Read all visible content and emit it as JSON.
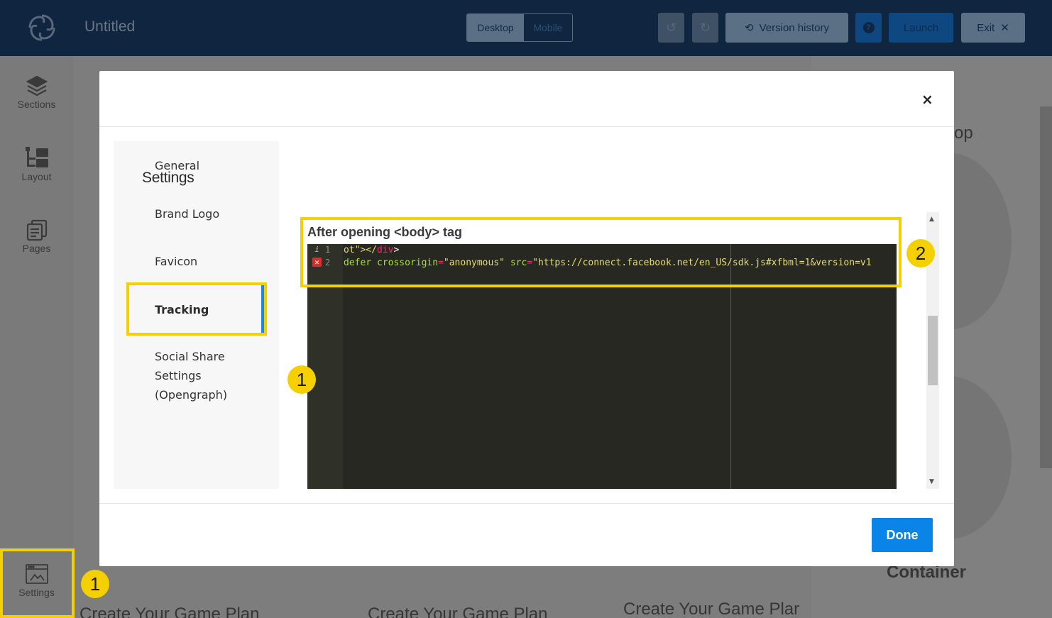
{
  "app": {
    "doc_title": "Untitled",
    "device_toggle": {
      "desktop": "Desktop",
      "mobile": "Mobile"
    },
    "toolbar": {
      "version_history": "Version history",
      "help": "?",
      "launch": "Launch",
      "exit": "Exit"
    }
  },
  "sidebar": {
    "items": [
      {
        "label": "Sections",
        "icon": "layers-icon"
      },
      {
        "label": "Layout",
        "icon": "layout-icon"
      },
      {
        "label": "Pages",
        "icon": "pages-icon"
      },
      {
        "label": "Settings",
        "icon": "settings-icon"
      }
    ]
  },
  "background": {
    "texts": [
      "Create Your Game Plan",
      "Create Your Game Plan",
      "Create Your Game Plar",
      "Container",
      "op"
    ]
  },
  "modal": {
    "close": "×",
    "nav_title": "Settings",
    "nav_items": [
      {
        "label": "General"
      },
      {
        "label": "Brand Logo"
      },
      {
        "label": "Favicon"
      },
      {
        "label": "Tracking",
        "active": true
      },
      {
        "label": "Social Share Settings (Opengraph)"
      }
    ],
    "code_label": "After opening <body> tag",
    "code_lines": [
      {
        "num": "1",
        "marker": "i",
        "text_before": "ot\"></",
        "tag": "div",
        "text_after": ">"
      },
      {
        "num": "2",
        "marker": "✕",
        "attr1": "defer crossorigin",
        "eq1": "=",
        "val1": "\"anonymous\"",
        "attr2": "src",
        "eq2": "=",
        "val2": "\"https://connect.facebook.net/en_US/sdk.js#xfbml=1&version=v1"
      }
    ],
    "done": "Done"
  },
  "annotations": {
    "badge_1": "1",
    "badge_2": "2"
  },
  "colors": {
    "highlight": "#f5d000",
    "accent": "#1e88e5",
    "done_button": "#0a84e6",
    "topbar": "#0f2540"
  }
}
